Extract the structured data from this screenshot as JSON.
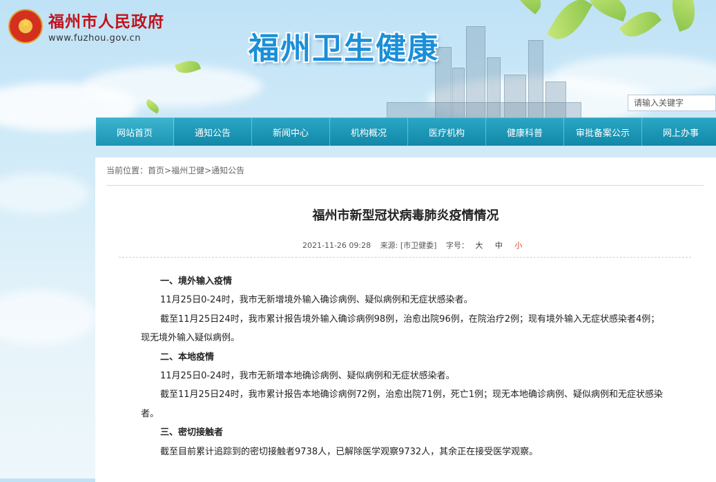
{
  "header": {
    "site_name": "福州市人民政府",
    "site_url": "www.fuzhou.gov.cn",
    "banner_title": "福州卫生健康"
  },
  "search": {
    "placeholder": "请输入关键字"
  },
  "nav": [
    {
      "label": "网站首页"
    },
    {
      "label": "通知公告"
    },
    {
      "label": "新闻中心"
    },
    {
      "label": "机构概况"
    },
    {
      "label": "医疗机构"
    },
    {
      "label": "健康科普"
    },
    {
      "label": "审批备案公示"
    },
    {
      "label": "网上办事"
    }
  ],
  "breadcrumb": {
    "prefix": "当前位置：",
    "items": [
      "首页",
      "福州卫健",
      "通知公告"
    ],
    "sep": ">"
  },
  "article": {
    "title": "福州市新型冠状病毒肺炎疫情情况",
    "date": "2021-11-26 09:28",
    "source": "来源: [市卫健委]",
    "font_size_label": "字号：",
    "font_sizes": [
      "大",
      "中",
      "小"
    ],
    "paragraphs": [
      {
        "type": "heading",
        "text": "一、境外输入疫情"
      },
      {
        "type": "text",
        "text": "11月25日0-24时，我市无新增境外输入确诊病例、疑似病例和无症状感染者。"
      },
      {
        "type": "text",
        "text": "截至11月25日24时，我市累计报告境外输入确诊病例98例，治愈出院96例，在院治疗2例；现有境外输入无症状感染者4例；现无境外输入疑似病例。"
      },
      {
        "type": "heading",
        "text": "二、本地疫情"
      },
      {
        "type": "text",
        "text": "11月25日0-24时，我市无新增本地确诊病例、疑似病例和无症状感染者。"
      },
      {
        "type": "text",
        "text": "截至11月25日24时，我市累计报告本地确诊病例72例，治愈出院71例，死亡1例；现无本地确诊病例、疑似病例和无症状感染者。"
      },
      {
        "type": "heading",
        "text": "三、密切接触者"
      },
      {
        "type": "text",
        "text": "截至目前累计追踪到的密切接触者9738人，已解除医学观察9732人，其余正在接受医学观察。"
      }
    ]
  },
  "colors": {
    "brand_red": "#c1121c",
    "nav_teal": "#1c95b4",
    "banner_blue": "#1a8fd8",
    "active_font_size": "#d9401c"
  }
}
